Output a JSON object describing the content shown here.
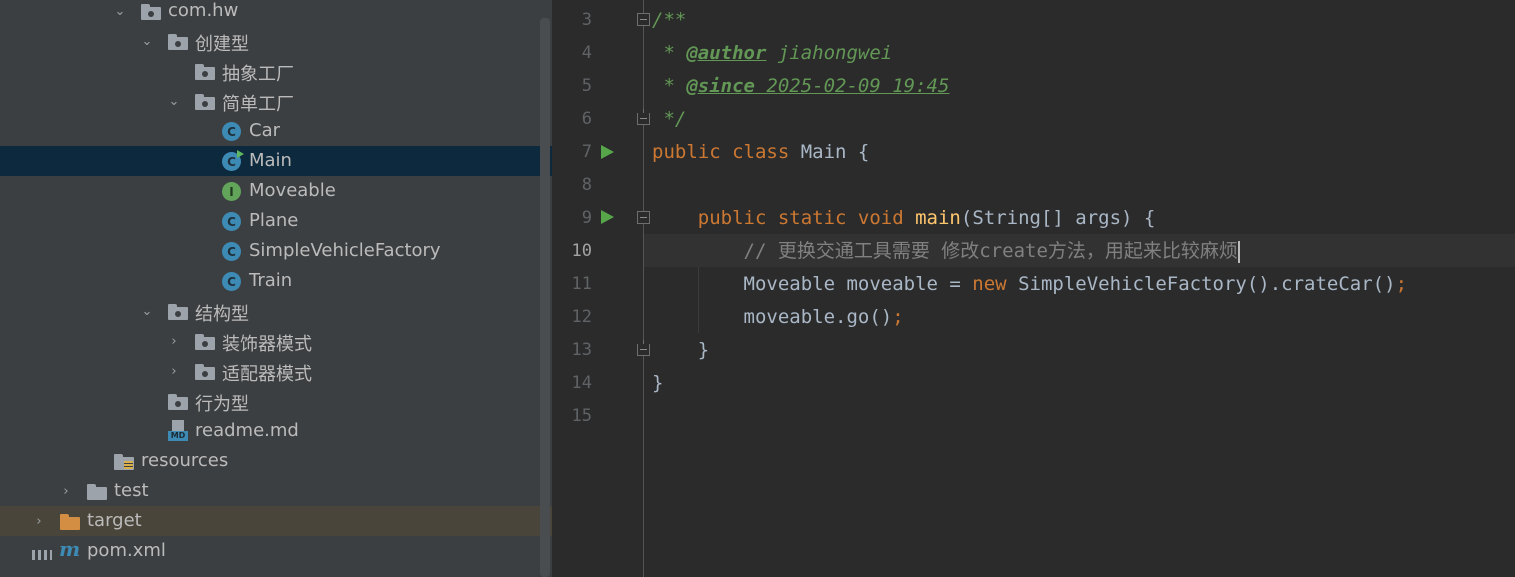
{
  "project_tree": {
    "items": [
      {
        "label": "com.hw",
        "kind": "package",
        "expanded": true
      },
      {
        "label": "创建型",
        "kind": "package",
        "expanded": true
      },
      {
        "label": "抽象工厂",
        "kind": "package"
      },
      {
        "label": "简单工厂",
        "kind": "package",
        "expanded": true
      },
      {
        "label": "Car",
        "kind": "class"
      },
      {
        "label": "Main",
        "kind": "class-main",
        "selected": true
      },
      {
        "label": "Moveable",
        "kind": "interface"
      },
      {
        "label": "Plane",
        "kind": "class"
      },
      {
        "label": "SimpleVehicleFactory",
        "kind": "class"
      },
      {
        "label": "Train",
        "kind": "class"
      },
      {
        "label": "结构型",
        "kind": "package",
        "expanded": true
      },
      {
        "label": "装饰器模式",
        "kind": "package",
        "collapsed": true
      },
      {
        "label": "适配器模式",
        "kind": "package",
        "collapsed": true
      },
      {
        "label": "行为型",
        "kind": "package"
      },
      {
        "label": "readme.md",
        "kind": "markdown"
      },
      {
        "label": "resources",
        "kind": "resources"
      },
      {
        "label": "test",
        "kind": "folder",
        "collapsed": true
      },
      {
        "label": "target",
        "kind": "excluded-folder",
        "collapsed": true
      },
      {
        "label": "pom.xml",
        "kind": "maven"
      }
    ],
    "icons": {
      "class_letter": "C",
      "interface_letter": "I",
      "markdown_tag": "MD",
      "maven_letter": "m"
    }
  },
  "editor": {
    "line_numbers": [
      "3",
      "4",
      "5",
      "6",
      "7",
      "8",
      "9",
      "10",
      "11",
      "12",
      "13",
      "14",
      "15"
    ],
    "current_line": "10",
    "code": {
      "l3": "/**",
      "l4_star": " * ",
      "l4_tag": "@author",
      "l4_value": " jiahongwei",
      "l5_star": " * ",
      "l5_tag": "@since",
      "l5_value": " 2025-02-09 19:45",
      "l6": " */",
      "l7_kw": "public class ",
      "l7_rest": "Main {",
      "l9_indent": "    ",
      "l9_kw": "public static void ",
      "l9_fn": "main",
      "l9_rest": "(String[] args) {",
      "l10_indent": "        ",
      "l10_comment": "// 更换交通工具需要 修改create方法，用起来比较麻烦",
      "l11_indent": "        ",
      "l11_a": "Moveable moveable = ",
      "l11_kw": "new ",
      "l11_b": "SimpleVehicleFactory().crateCar()",
      "l11_semi": ";",
      "l12_indent": "        ",
      "l12_a": "moveable.go()",
      "l12_semi": ";",
      "l13": "    }",
      "l14": "}"
    }
  },
  "colors": {
    "tree_bg": "#3c3f41",
    "editor_bg": "#2b2b2b",
    "selection": "#0d293e",
    "keyword": "#cc7832",
    "doc_comment": "#629755",
    "function": "#ffc66d",
    "comment": "#808080",
    "text": "#a9b7c6"
  }
}
